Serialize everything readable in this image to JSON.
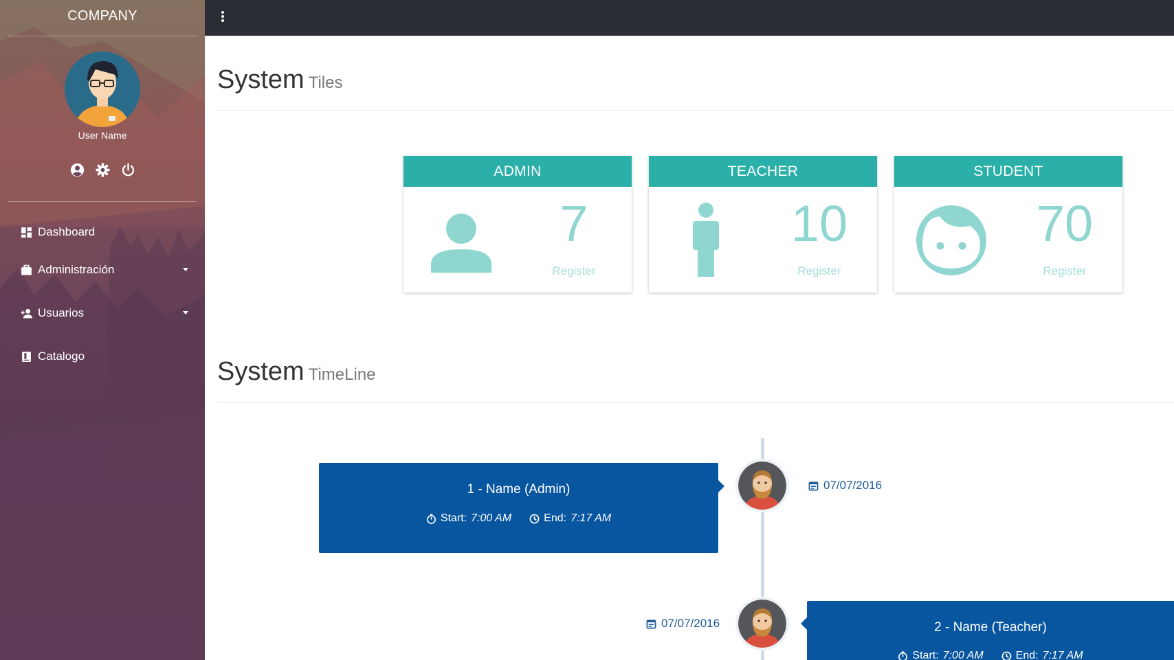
{
  "sidebar": {
    "company": "COMPANY",
    "user_name": "User Name",
    "icons": [
      "account-circle-icon",
      "gear-icon",
      "power-icon"
    ],
    "nav": [
      {
        "label": "Dashboard",
        "icon": "dashboard-icon",
        "has_caret": false
      },
      {
        "label": "Administración",
        "icon": "briefcase-icon",
        "has_caret": true
      },
      {
        "label": "Usuarios",
        "icon": "add-user-icon",
        "has_caret": true
      },
      {
        "label": "Catalogo",
        "icon": "book-icon",
        "has_caret": false
      }
    ]
  },
  "topbar": {
    "menu_icon": "kebab-menu-icon"
  },
  "tiles_section": {
    "title": "System",
    "subtitle": "Tiles"
  },
  "tiles": [
    {
      "header": "ADMIN",
      "value": "7",
      "caption": "Register",
      "icon": "person-icon"
    },
    {
      "header": "TEACHER",
      "value": "10",
      "caption": "Register",
      "icon": "standing-person-icon"
    },
    {
      "header": "STUDENT",
      "value": "70",
      "caption": "Register",
      "icon": "child-face-icon"
    }
  ],
  "timeline_section": {
    "title": "System",
    "subtitle": "TimeLine"
  },
  "timeline": [
    {
      "title": "1 - Name (Admin)",
      "start_label": "Start:",
      "start": "7:00 AM",
      "end_label": "End:",
      "end": "7:17 AM",
      "date": "07/07/2016"
    },
    {
      "title": "2 - Name (Teacher)",
      "start_label": "Start:",
      "start": "7:00 AM",
      "end_label": "End:",
      "end": "7:17 AM",
      "date": "07/07/2016"
    }
  ],
  "colors": {
    "tile_header": "#2ab0a8",
    "tile_value": "#8fd6d1",
    "timeline_card": "#08569f",
    "topbar": "#2b2d35"
  }
}
